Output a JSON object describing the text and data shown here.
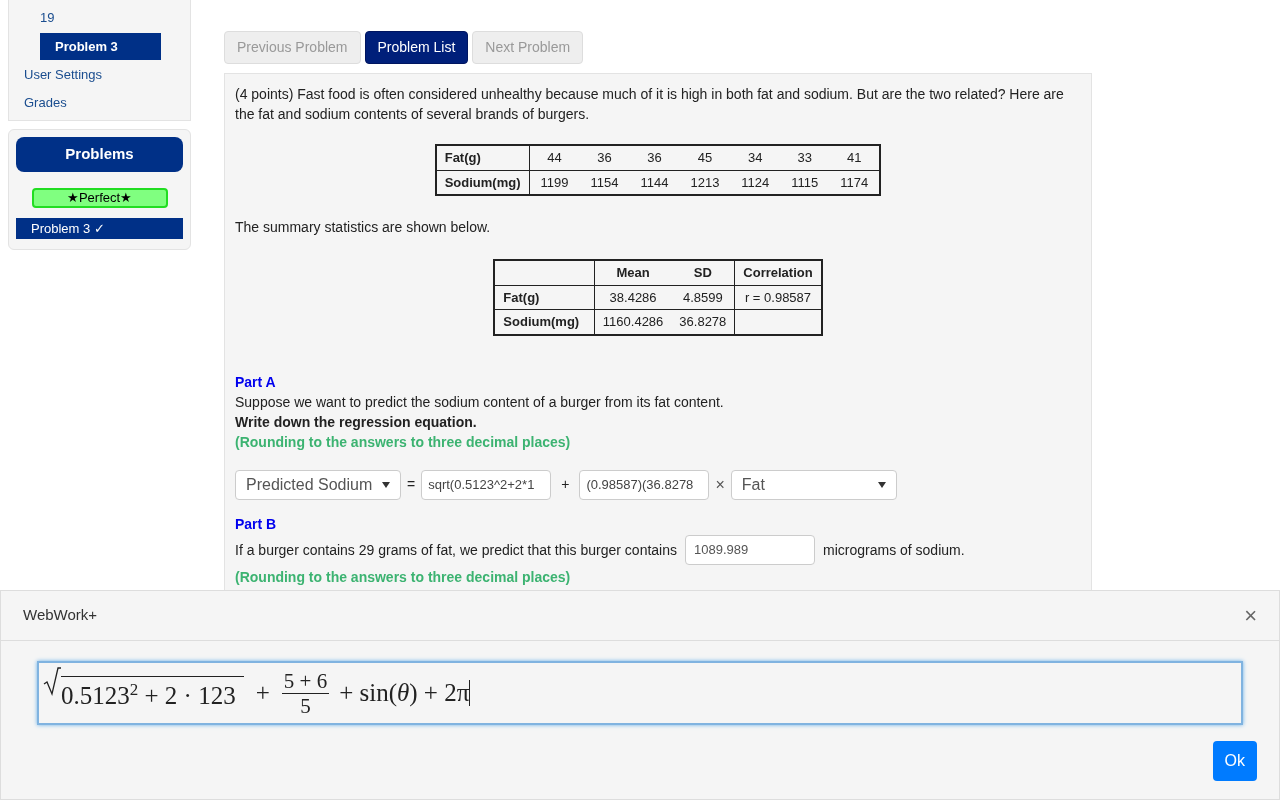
{
  "sidebar": {
    "nav": [
      {
        "label": "19",
        "selected": false,
        "indented": true
      },
      {
        "label": "Problem 3",
        "selected": true,
        "indented": true
      },
      {
        "label": "User Settings",
        "selected": false,
        "indented": false
      },
      {
        "label": "Grades",
        "selected": false,
        "indented": false
      }
    ],
    "problems_panel": {
      "title": "Problems",
      "badge": "★Perfect★",
      "items": [
        {
          "label": "Problem 3 ✓",
          "selected": true
        }
      ]
    }
  },
  "nav_buttons": [
    {
      "label": "Previous Problem",
      "disabled": true,
      "primary": false
    },
    {
      "label": "Problem List",
      "disabled": false,
      "primary": true
    },
    {
      "label": "Next Problem",
      "disabled": true,
      "primary": false
    }
  ],
  "problem": {
    "intro": "(4 points) Fast food is often considered unhealthy because much of it is high in both fat and sodium. But are the two related? Here are the fat and sodium contents of several brands of burgers.",
    "data_table": {
      "rows": [
        {
          "header": "Fat(g)",
          "values": [
            "44",
            "36",
            "36",
            "45",
            "34",
            "33",
            "41"
          ]
        },
        {
          "header": "Sodium(mg)",
          "values": [
            "1199",
            "1154",
            "1144",
            "1213",
            "1124",
            "1115",
            "1174"
          ]
        }
      ]
    },
    "summary_text": "The summary statistics are shown below.",
    "summary_table": {
      "columns": [
        "Mean",
        "SD",
        "Correlation"
      ],
      "rows": [
        {
          "header": "Fat(g)",
          "cells": [
            "38.4286",
            "4.8599",
            "r = 0.98587"
          ]
        },
        {
          "header": "Sodium(mg)",
          "cells": [
            "1160.4286",
            "36.8278",
            null
          ]
        }
      ]
    },
    "part_a": {
      "title": "Part A",
      "text": "Suppose we want to predict the sodium content of a burger from its fat content.",
      "instruction": "Write down the regression equation.",
      "note": "(Rounding to the answers to three decimal places)",
      "equation": {
        "left_select": "Predicted Sodium",
        "equals": "=",
        "intercept": "sqrt(0.5123^2+2*1",
        "plus": "+",
        "slope": "(0.98587)(36.8278",
        "times": "×",
        "right_select": "Fat"
      }
    },
    "part_b": {
      "title": "Part B",
      "text_before": "If a burger contains 29 grams of fat, we predict that this burger contains",
      "answer": "1089.989",
      "text_after": "micrograms of sodium.",
      "note": "(Rounding to the answers to three decimal places)"
    }
  },
  "dialog": {
    "title": "WebWork+",
    "close": "×",
    "math": {
      "base": "0.5123",
      "exponent": "2",
      "rest": "+ 2 · 123",
      "plus": "+",
      "numerator": "5 + 6",
      "denominator": "5",
      "tail_start": "+ sin(",
      "variable": "θ",
      "tail_end": ") + 2π"
    },
    "ok": "Ok"
  }
}
